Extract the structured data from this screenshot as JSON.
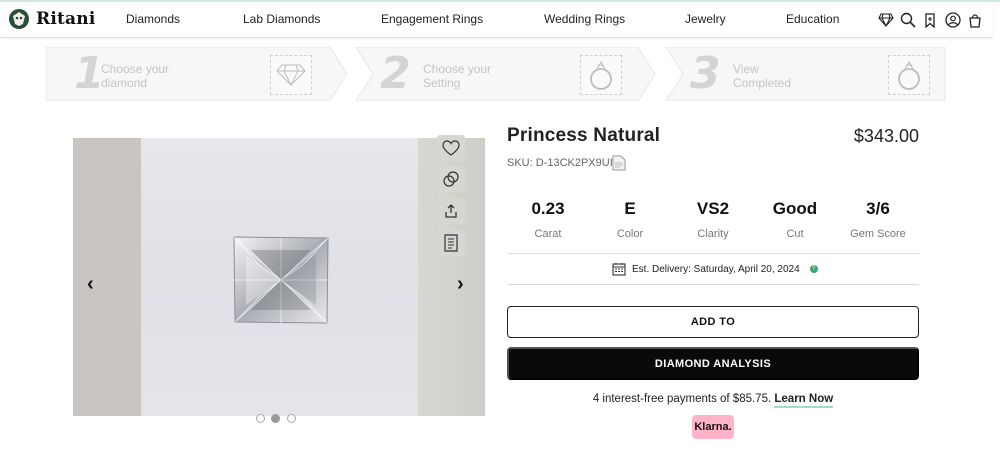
{
  "brand": {
    "name": "Ritani"
  },
  "nav": {
    "items": [
      "Diamonds",
      "Lab Diamonds",
      "Engagement Rings",
      "Wedding Rings",
      "Jewelry",
      "Education"
    ]
  },
  "header_icons": [
    "diamond-icon",
    "search-icon",
    "bookmark-icon",
    "account-icon",
    "cart-icon"
  ],
  "steps": [
    {
      "number": "1",
      "line1": "Choose your",
      "line2": "diamond"
    },
    {
      "number": "2",
      "line1": "Choose your",
      "line2": "Setting"
    },
    {
      "number": "3",
      "line1": "View",
      "line2": "Completed"
    }
  ],
  "gallery": {
    "total_images": 3,
    "active_index": 1
  },
  "product": {
    "title": "Princess Natural",
    "price": "$343.00",
    "sku": "SKU: D-13CK2PX9UI"
  },
  "specs": [
    {
      "value": "0.23",
      "label": "Carat"
    },
    {
      "value": "E",
      "label": "Color"
    },
    {
      "value": "VS2",
      "label": "Clarity"
    },
    {
      "value": "Good",
      "label": "Cut"
    },
    {
      "value": "3/6",
      "label": "Gem Score"
    }
  ],
  "delivery": {
    "text": "Est. Delivery: Saturday, April 20, 2024"
  },
  "actions": {
    "add_label": "ADD TO",
    "analysis_label": "DIAMOND ANALYSIS"
  },
  "financing": {
    "text": "4 interest-free payments of $85.75.",
    "link": "Learn Now",
    "provider": "Klarna."
  },
  "colors": {
    "primary_button": "#0a0a0a",
    "klarna_pink": "#ffb3c7",
    "accent_green": "#3aa873"
  }
}
